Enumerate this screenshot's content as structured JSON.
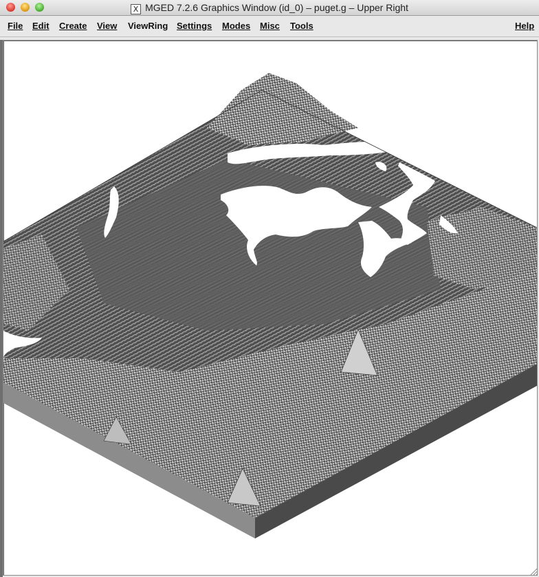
{
  "window": {
    "title": "MGED 7.2.6 Graphics Window (id_0) – puget.g – Upper Right",
    "title_icon": "X"
  },
  "menubar": {
    "file": "File",
    "edit": "Edit",
    "create": "Create",
    "view": "View",
    "viewring": "ViewRing",
    "settings": "Settings",
    "modes": "Modes",
    "misc": "Misc",
    "tools": "Tools",
    "help": "Help"
  },
  "colors": {
    "terrain_top": "#5e5e5e",
    "terrain_side_left": "#8a8a8a",
    "terrain_side_right": "#4a4a4a",
    "water": "#ffffff",
    "canvas": "#ffffff"
  }
}
